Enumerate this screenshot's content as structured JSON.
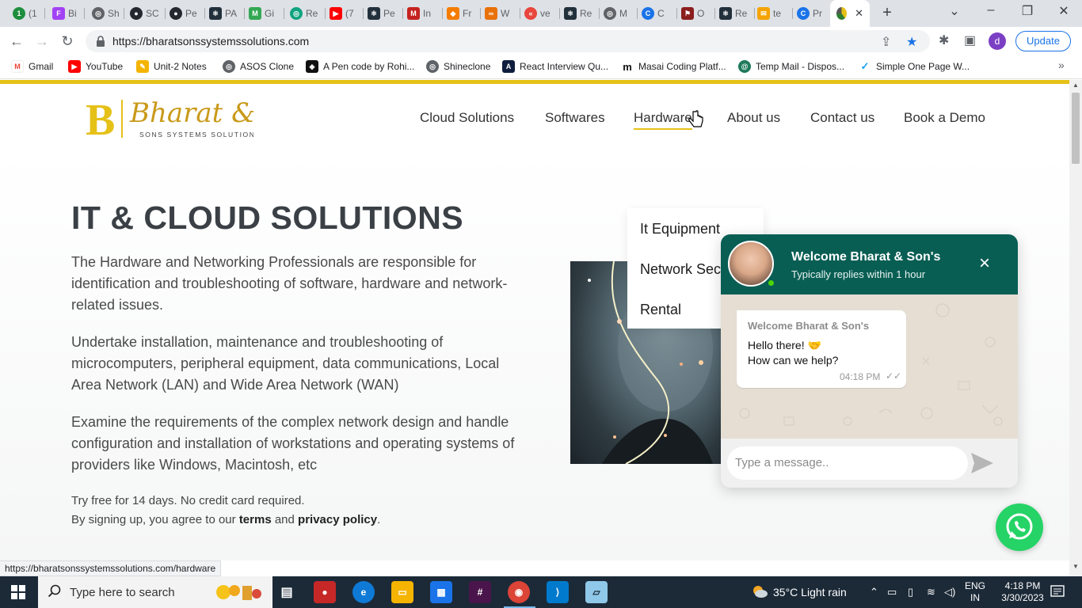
{
  "browser": {
    "tabs": [
      {
        "label": "(1",
        "color": "#1e8e3e",
        "glyph": "1"
      },
      {
        "label": "Bi",
        "color": "#a142f4",
        "glyph": "F"
      },
      {
        "label": "Sh",
        "color": "#5f6368",
        "glyph": "◎"
      },
      {
        "label": "SC",
        "color": "#24292f",
        "glyph": "●"
      },
      {
        "label": "Pe",
        "color": "#24292f",
        "glyph": "●"
      },
      {
        "label": "PA",
        "color": "#22303c",
        "glyph": "⚛"
      },
      {
        "label": "Gi",
        "color": "#34a853",
        "glyph": "M"
      },
      {
        "label": "Re",
        "color": "#10a37f",
        "glyph": "◎"
      },
      {
        "label": "(7",
        "color": "#ff0000",
        "glyph": "▶"
      },
      {
        "label": "Pe",
        "color": "#22303c",
        "glyph": "⚛"
      },
      {
        "label": "In",
        "color": "#c5221f",
        "glyph": "M"
      },
      {
        "label": "Fr",
        "color": "#f57c00",
        "glyph": "◆"
      },
      {
        "label": "W",
        "color": "#e8710a",
        "glyph": "∞"
      },
      {
        "label": "ve",
        "color": "#e8453c",
        "glyph": "«"
      },
      {
        "label": "Re",
        "color": "#22303c",
        "glyph": "⚛"
      },
      {
        "label": "M",
        "color": "#5f6368",
        "glyph": "◎"
      },
      {
        "label": "C",
        "color": "#1a73e8",
        "glyph": "C"
      },
      {
        "label": "O",
        "color": "#8b1d1d",
        "glyph": "⚑"
      },
      {
        "label": "Re",
        "color": "#22303c",
        "glyph": "⚛"
      },
      {
        "label": "te",
        "color": "#f6a400",
        "glyph": "✉"
      },
      {
        "label": "Pr",
        "color": "#1a73e8",
        "glyph": "C"
      }
    ],
    "active_tab_close": "✕",
    "new_tab": "+",
    "url": "https://bharatsonssystemssolutions.com",
    "update_label": "Update",
    "profile_initial": "d",
    "status_url": "https://bharatsonssystemssolutions.com/hardware"
  },
  "bookmarks": [
    {
      "label": "Gmail",
      "color": "#ea4335",
      "glyph": "M"
    },
    {
      "label": "YouTube",
      "color": "#ff0000",
      "glyph": "▶"
    },
    {
      "label": "Unit-2 Notes",
      "color": "#f4b400",
      "glyph": "✎"
    },
    {
      "label": "ASOS Clone",
      "color": "#5f6368",
      "glyph": "◎"
    },
    {
      "label": "A Pen code by Rohi...",
      "color": "#111111",
      "glyph": "◈"
    },
    {
      "label": "Shineclone",
      "color": "#5f6368",
      "glyph": "◎"
    },
    {
      "label": "React Interview Qu...",
      "color": "#0f1e3d",
      "glyph": "A"
    },
    {
      "label": "Masai Coding Platf...",
      "color": "#ffffff",
      "glyph": "m"
    },
    {
      "label": "Temp Mail - Dispos...",
      "color": "#1e7a5a",
      "glyph": "@"
    },
    {
      "label": "Simple One Page W...",
      "color": "#1da1f2",
      "glyph": "✓"
    }
  ],
  "site": {
    "logo_letter": "B",
    "logo_script": "Bharat &",
    "logo_tagline": "SONS SYSTEMS SOLUTIONS",
    "nav": [
      "Cloud Solutions",
      "Softwares",
      "Hardware",
      "About us",
      "Contact us",
      "Book a Demo"
    ],
    "dropdown": [
      "It Equipment",
      "Network Security",
      "Rental"
    ],
    "hero_title": "IT & CLOUD SOLUTIONS",
    "paragraphs": [
      "The Hardware and Networking Professionals are responsible for identification and troubleshooting of software, hardware and network-related issues.",
      "Undertake installation, maintenance and troubleshooting of microcomputers, peripheral equipment, data communications, Local Area Network (LAN) and Wide Area Network (WAN)",
      "Examine the requirements of the complex network design and handle configuration and installation of workstations and operating systems of providers like Windows, Macintosh, etc"
    ],
    "trial_line": "Try free for 14 days. No credit card required.",
    "signup_prefix": "By signing up, you agree to our ",
    "terms": "terms",
    "and": " and ",
    "privacy": "privacy policy",
    "period": "."
  },
  "chat": {
    "title": "Welcome Bharat & Son's",
    "subtitle": "Typically replies within 1 hour",
    "message_sender": "Welcome Bharat & Son's",
    "message_line1": "Hello there! 🤝",
    "message_line2": "How can we help?",
    "message_time": "04:18 PM",
    "input_placeholder": "Type a message.."
  },
  "taskbar": {
    "search_placeholder": "Type here to search",
    "weather": "35°C  Light rain",
    "lang_line1": "ENG",
    "lang_line2": "IN",
    "time": "4:18 PM",
    "date": "3/30/2023"
  },
  "colors": {
    "brand_gold": "#e5c118",
    "whatsapp_green": "#25d366",
    "chat_header": "#095e54"
  }
}
